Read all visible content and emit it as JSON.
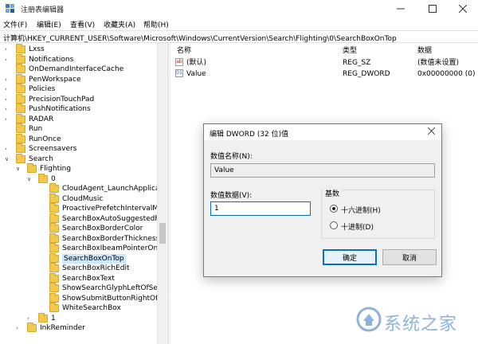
{
  "window": {
    "title": "注册表编辑器",
    "min_icon": "minimize-icon",
    "max_icon": "maximize-icon",
    "close_icon": "close-icon"
  },
  "menu": {
    "items": [
      {
        "label": "文件(F)"
      },
      {
        "label": "编辑(E)"
      },
      {
        "label": "查看(V)"
      },
      {
        "label": "收藏夹(A)"
      },
      {
        "label": "帮助(H)"
      }
    ]
  },
  "address": {
    "path": "计算机\\HKEY_CURRENT_USER\\Software\\Microsoft\\Windows\\CurrentVersion\\Search\\Flighting\\0\\SearchBoxOnTop"
  },
  "tree": {
    "items": [
      {
        "label": "Lxss",
        "level": 0,
        "expander": ">"
      },
      {
        "label": "Notifications",
        "level": 0,
        "expander": ">"
      },
      {
        "label": "OnDemandInterfaceCache",
        "level": 0,
        "expander": ""
      },
      {
        "label": "PenWorkspace",
        "level": 0,
        "expander": ">"
      },
      {
        "label": "Policies",
        "level": 0,
        "expander": ">"
      },
      {
        "label": "PrecisionTouchPad",
        "level": 0,
        "expander": ">"
      },
      {
        "label": "PushNotifications",
        "level": 0,
        "expander": ">"
      },
      {
        "label": "RADAR",
        "level": 0,
        "expander": ">"
      },
      {
        "label": "Run",
        "level": 0,
        "expander": ""
      },
      {
        "label": "RunOnce",
        "level": 0,
        "expander": ""
      },
      {
        "label": "Screensavers",
        "level": 0,
        "expander": ">"
      },
      {
        "label": "Search",
        "level": 0,
        "expander": "v"
      },
      {
        "label": "Flighting",
        "level": 1,
        "expander": "v"
      },
      {
        "label": "0",
        "level": 2,
        "expander": "v"
      },
      {
        "label": "CloudAgent_LaunchApplicati",
        "level": 3,
        "expander": ""
      },
      {
        "label": "CloudMusic",
        "level": 3,
        "expander": ""
      },
      {
        "label": "ProactivePrefetchIntervalMin",
        "level": 3,
        "expander": ""
      },
      {
        "label": "SearchBoxAutoSuggestedFo",
        "level": 3,
        "expander": ""
      },
      {
        "label": "SearchBoxBorderColor",
        "level": 3,
        "expander": ""
      },
      {
        "label": "SearchBoxBorderThickness",
        "level": 3,
        "expander": ""
      },
      {
        "label": "SearchBoxIbeamPointerOnH",
        "level": 3,
        "expander": ""
      },
      {
        "label": "SearchBoxOnTop",
        "level": 3,
        "expander": "",
        "selected": true
      },
      {
        "label": "SearchBoxRichEdit",
        "level": 3,
        "expander": ""
      },
      {
        "label": "SearchBoxText",
        "level": 3,
        "expander": ""
      },
      {
        "label": "ShowSearchGlyphLeftOfSear",
        "level": 3,
        "expander": ""
      },
      {
        "label": "ShowSubmitButtonRightOfSe",
        "level": 3,
        "expander": ""
      },
      {
        "label": "WhiteSearchBox",
        "level": 3,
        "expander": ""
      },
      {
        "label": "1",
        "level": 2,
        "expander": ">"
      },
      {
        "label": "InkReminder",
        "level": 1,
        "expander": ">"
      }
    ]
  },
  "values_pane": {
    "headers": {
      "name": "名称",
      "type": "类型",
      "data": "数据"
    },
    "rows": [
      {
        "icon": "ab",
        "name": "(默认)",
        "type": "REG_SZ",
        "data": "(数值未设置)"
      },
      {
        "icon": "01",
        "name": "Value",
        "type": "REG_DWORD",
        "data": "0x00000000 (0)"
      }
    ]
  },
  "dialog": {
    "title": "编辑 DWORD (32 位)值",
    "name_label": "数值名称(N):",
    "name_value": "Value",
    "data_label": "数值数据(V):",
    "data_value": "1",
    "base_label": "基数",
    "hex_label": "十六进制(H)",
    "dec_label": "十进制(D)",
    "hex_selected": true,
    "ok_label": "确定",
    "cancel_label": "取消"
  },
  "watermark": {
    "text": "系统之家"
  }
}
